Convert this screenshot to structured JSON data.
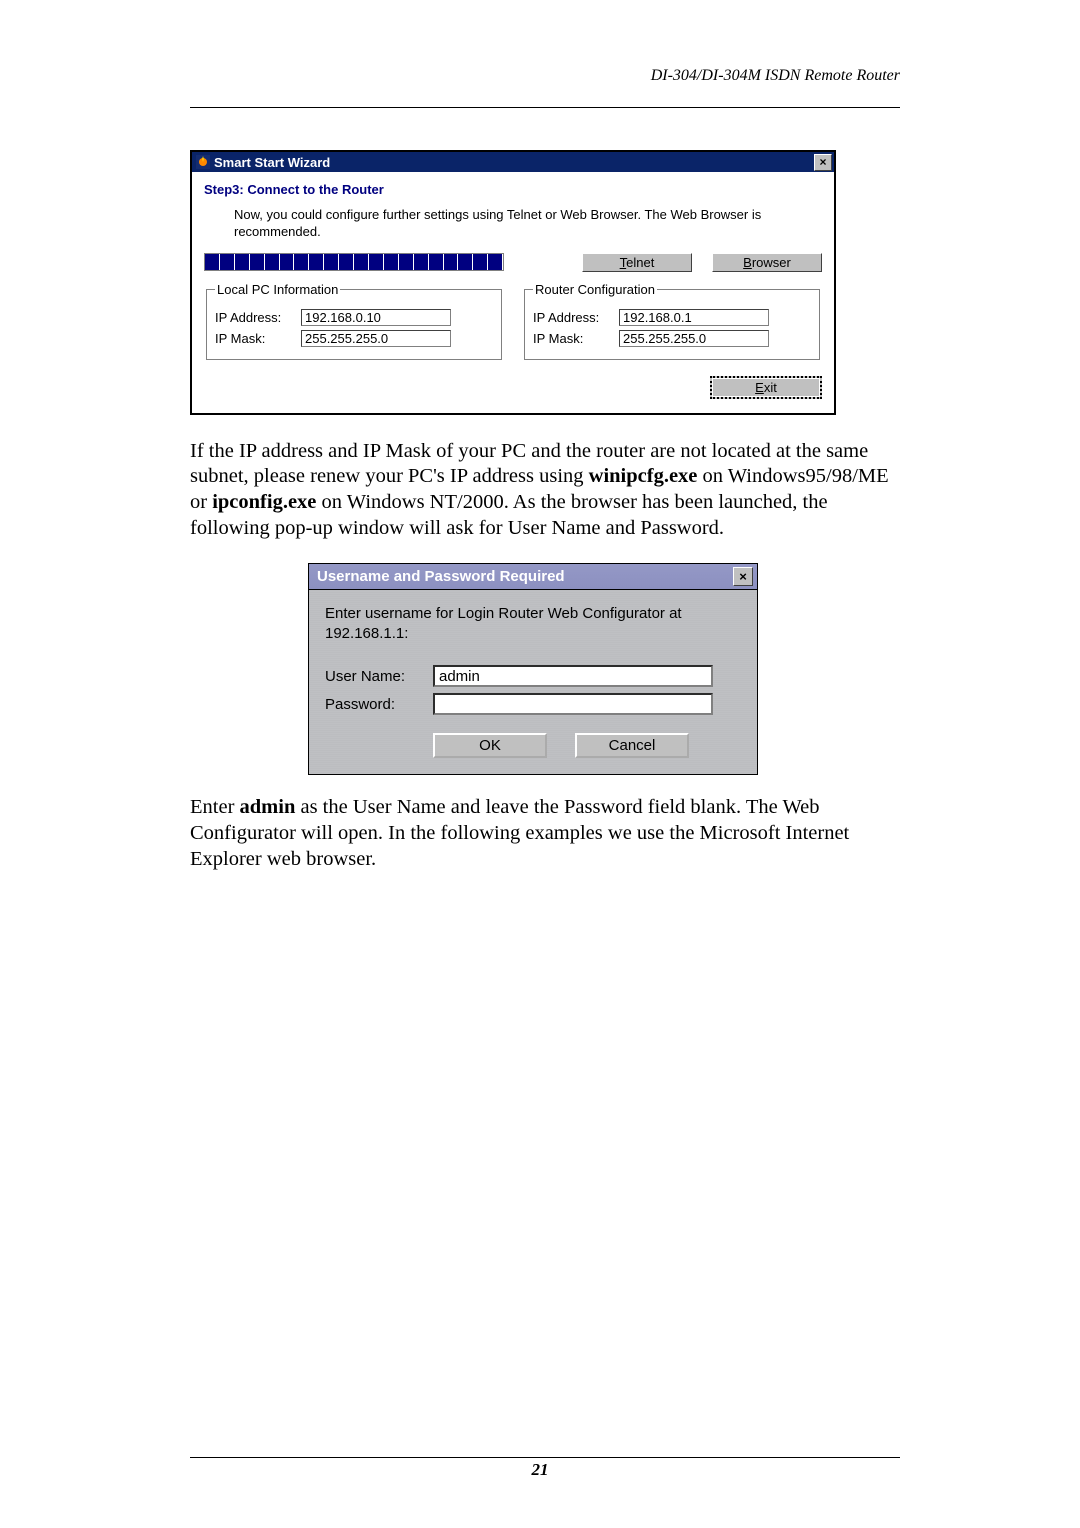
{
  "header": {
    "title": "DI-304/DI-304M ISDN Remote Router"
  },
  "wizard": {
    "window_title": "Smart Start Wizard",
    "step_title": "Step3: Connect to the Router",
    "instruction": "Now, you could configure further settings using Telnet or Web Browser. The Web Browser is recommended.",
    "telnet_btn_pre": "T",
    "telnet_btn_rest": "elnet",
    "browser_btn_pre": "B",
    "browser_btn_rest": "rowser",
    "local_legend": "Local PC Information",
    "router_legend": "Router Configuration",
    "ip_label": "IP Address:",
    "mask_label": "IP Mask:",
    "local_ip": "192.168.0.10",
    "local_mask": "255.255.255.0",
    "router_ip": "192.168.0.1",
    "router_mask": "255.255.255.0",
    "exit_pre": "E",
    "exit_rest": "xit"
  },
  "para1": {
    "t1": "If the IP address and IP Mask of your PC and the router are not located at the same subnet, please renew your PC's IP address using ",
    "b1": "winipcfg.exe",
    "t2": " on Windows95/98/ME or ",
    "b2": "ipconfig.exe",
    "t3": " on Windows NT/2000. As the browser has been launched, the following pop-up window will ask for User Name and Password."
  },
  "login": {
    "title": "Username and Password Required",
    "instruction": "Enter username for Login Router Web Configurator at 192.168.1.1:",
    "user_label": "User Name:",
    "pass_label": "Password:",
    "user_value": "admin",
    "pass_value": "",
    "ok": "OK",
    "cancel": "Cancel"
  },
  "para2": {
    "t1": "Enter ",
    "b1": "admin",
    "t2": " as the User Name and leave the Password field blank. The Web Configurator will open. In the following examples we use the Microsoft Internet Explorer web browser."
  },
  "page_number": "21"
}
